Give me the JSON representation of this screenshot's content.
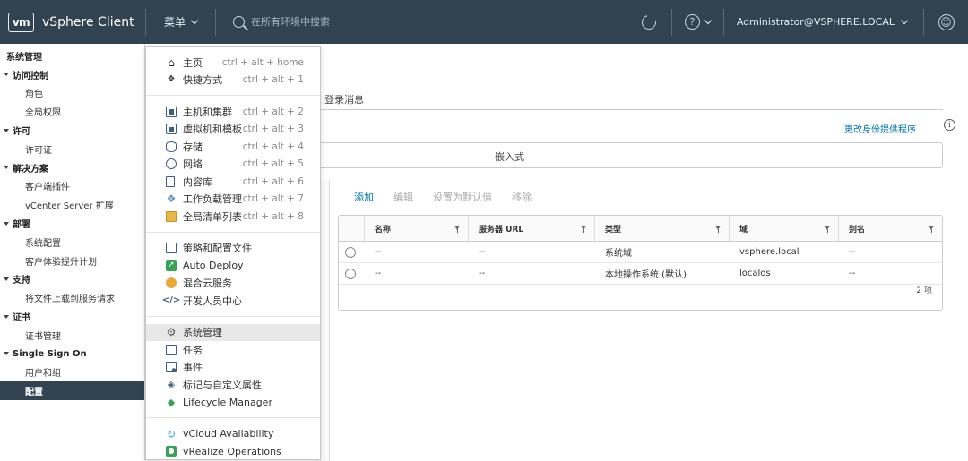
{
  "header": {
    "logo": "vm",
    "app_title": "vSphere Client",
    "menu_label": "菜单",
    "search_placeholder": "在所有环境中搜索",
    "help_label": "?",
    "user": "Administrator@VSPHERE.LOCAL"
  },
  "sidebar": {
    "title": "系统管理",
    "groups": [
      {
        "label": "访问控制",
        "items": [
          "角色",
          "全局权限"
        ]
      },
      {
        "label": "许可",
        "items": [
          "许可证"
        ]
      },
      {
        "label": "解决方案",
        "items": [
          "客户端插件",
          "vCenter Server 扩展"
        ]
      },
      {
        "label": "部署",
        "items": [
          "系统配置",
          "客户体验提升计划"
        ]
      },
      {
        "label": "支持",
        "items": [
          "将文件上载到服务请求"
        ]
      },
      {
        "label": "证书",
        "items": [
          "证书管理"
        ]
      },
      {
        "label": "Single Sign On",
        "items": [
          "用户和组",
          "配置"
        ]
      }
    ],
    "active_item": "配置"
  },
  "menu": {
    "groups": [
      [
        {
          "icon": "home-icon",
          "label": "主页",
          "shortcut": "ctrl + alt + home"
        },
        {
          "icon": "shortcuts-icon",
          "label": "快捷方式",
          "shortcut": "ctrl + alt + 1"
        }
      ],
      [
        {
          "icon": "hosts-clusters-icon",
          "label": "主机和集群",
          "shortcut": "ctrl + alt + 2"
        },
        {
          "icon": "vms-templates-icon",
          "label": "虚拟机和模板",
          "shortcut": "ctrl + alt + 3"
        },
        {
          "icon": "storage-icon",
          "label": "存储",
          "shortcut": "ctrl + alt + 4"
        },
        {
          "icon": "network-icon",
          "label": "网络",
          "shortcut": "ctrl + alt + 5"
        },
        {
          "icon": "content-library-icon",
          "label": "内容库",
          "shortcut": "ctrl + alt + 6"
        },
        {
          "icon": "workload-management-icon",
          "label": "工作负载管理",
          "shortcut": "ctrl + alt + 7"
        },
        {
          "icon": "global-inventory-icon",
          "label": "全局清单列表",
          "shortcut": "ctrl + alt + 8"
        }
      ],
      [
        {
          "icon": "policies-profiles-icon",
          "label": "策略和配置文件",
          "shortcut": ""
        },
        {
          "icon": "auto-deploy-icon",
          "label": "Auto Deploy",
          "shortcut": ""
        },
        {
          "icon": "hybrid-cloud-icon",
          "label": "混合云服务",
          "shortcut": ""
        },
        {
          "icon": "developer-center-icon",
          "label": "开发人员中心",
          "shortcut": ""
        }
      ],
      [
        {
          "icon": "administration-icon",
          "label": "系统管理",
          "shortcut": "",
          "selected": true
        },
        {
          "icon": "tasks-icon",
          "label": "任务",
          "shortcut": ""
        },
        {
          "icon": "events-icon",
          "label": "事件",
          "shortcut": ""
        },
        {
          "icon": "tags-icon",
          "label": "标记与自定义属性",
          "shortcut": ""
        },
        {
          "icon": "lifecycle-manager-icon",
          "label": "Lifecycle Manager",
          "shortcut": ""
        }
      ],
      [
        {
          "icon": "vcloud-availability-icon",
          "label": "vCloud Availability",
          "shortcut": ""
        },
        {
          "icon": "vrealize-operations-icon",
          "label": "vRealize Operations",
          "shortcut": ""
        }
      ]
    ]
  },
  "content": {
    "tab_login_message": "登录消息",
    "change_provider_link": "更改身份提供程序",
    "embedded_label": "嵌入式",
    "actions": {
      "add": "添加",
      "edit": "编辑",
      "set_default": "设置为默认值",
      "remove": "移除"
    },
    "table": {
      "columns": [
        "名称",
        "服务器 URL",
        "类型",
        "域",
        "别名"
      ],
      "rows": [
        {
          "name": "--",
          "url": "--",
          "type": "系统域",
          "domain": "vsphere.local",
          "alias": "--"
        },
        {
          "name": "--",
          "url": "--",
          "type": "本地操作系统 (默认)",
          "domain": "localos",
          "alias": "--"
        }
      ],
      "footer": "2 项"
    }
  }
}
